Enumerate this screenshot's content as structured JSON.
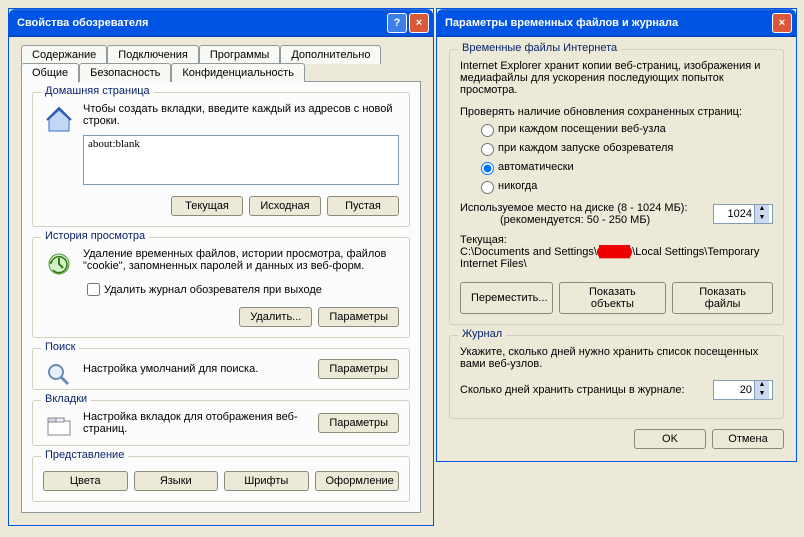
{
  "dialog1": {
    "title": "Свойства обозревателя",
    "tabs_row1": [
      "Содержание",
      "Подключения",
      "Программы",
      "Дополнительно"
    ],
    "tabs_row2": [
      "Общие",
      "Безопасность",
      "Конфиденциальность"
    ],
    "active_tab": "Общие",
    "home": {
      "legend": "Домашняя страница",
      "desc": "Чтобы создать вкладки, введите каждый из адресов с новой строки.",
      "value": "about:blank",
      "btn_current": "Текущая",
      "btn_default": "Исходная",
      "btn_blank": "Пустая"
    },
    "history": {
      "legend": "История просмотра",
      "desc": "Удаление временных файлов, истории просмотра, файлов \"cookie\", запомненных паролей и данных из веб-форм.",
      "checkbox": "Удалить журнал обозревателя при выходе",
      "btn_delete": "Удалить...",
      "btn_settings": "Параметры"
    },
    "search": {
      "legend": "Поиск",
      "desc": "Настройка умолчаний для поиска.",
      "btn": "Параметры"
    },
    "tabs_section": {
      "legend": "Вкладки",
      "desc": "Настройка вкладок для отображения веб-страниц.",
      "btn": "Параметры"
    },
    "appearance": {
      "legend": "Представление",
      "btn_colors": "Цвета",
      "btn_lang": "Языки",
      "btn_fonts": "Шрифты",
      "btn_acc": "Оформление"
    }
  },
  "dialog2": {
    "title": "Параметры временных файлов и журнала",
    "temp": {
      "legend": "Временные файлы Интернета",
      "desc": "Internet Explorer хранит копии веб-страниц, изображения и медиафайлы для ускорения последующих попыток просмотра.",
      "check_label": "Проверять наличие обновления сохраненных страниц:",
      "opt1": "при каждом посещении веб-узла",
      "opt2": "при каждом запуске обозревателя",
      "opt3": "автоматически",
      "opt4": "никогда",
      "disk_label": "Используемое место на диске (8 - 1024 МБ):",
      "disk_hint": "(рекомендуется: 50 - 250 МБ)",
      "disk_value": "1024",
      "folder_label": "Текущая:",
      "folder_path_pre": "C:\\Documents and Settings\\",
      "folder_path_post": "\\Local Settings\\Temporary Internet Files\\",
      "btn_move": "Переместить...",
      "btn_objects": "Показать объекты",
      "btn_files": "Показать файлы"
    },
    "journal": {
      "legend": "Журнал",
      "desc": "Укажите, сколько дней нужно хранить список посещенных вами веб-узлов.",
      "days_label": "Сколько дней хранить страницы в журнале:",
      "days_value": "20"
    },
    "btn_ok": "OK",
    "btn_cancel": "Отмена"
  }
}
